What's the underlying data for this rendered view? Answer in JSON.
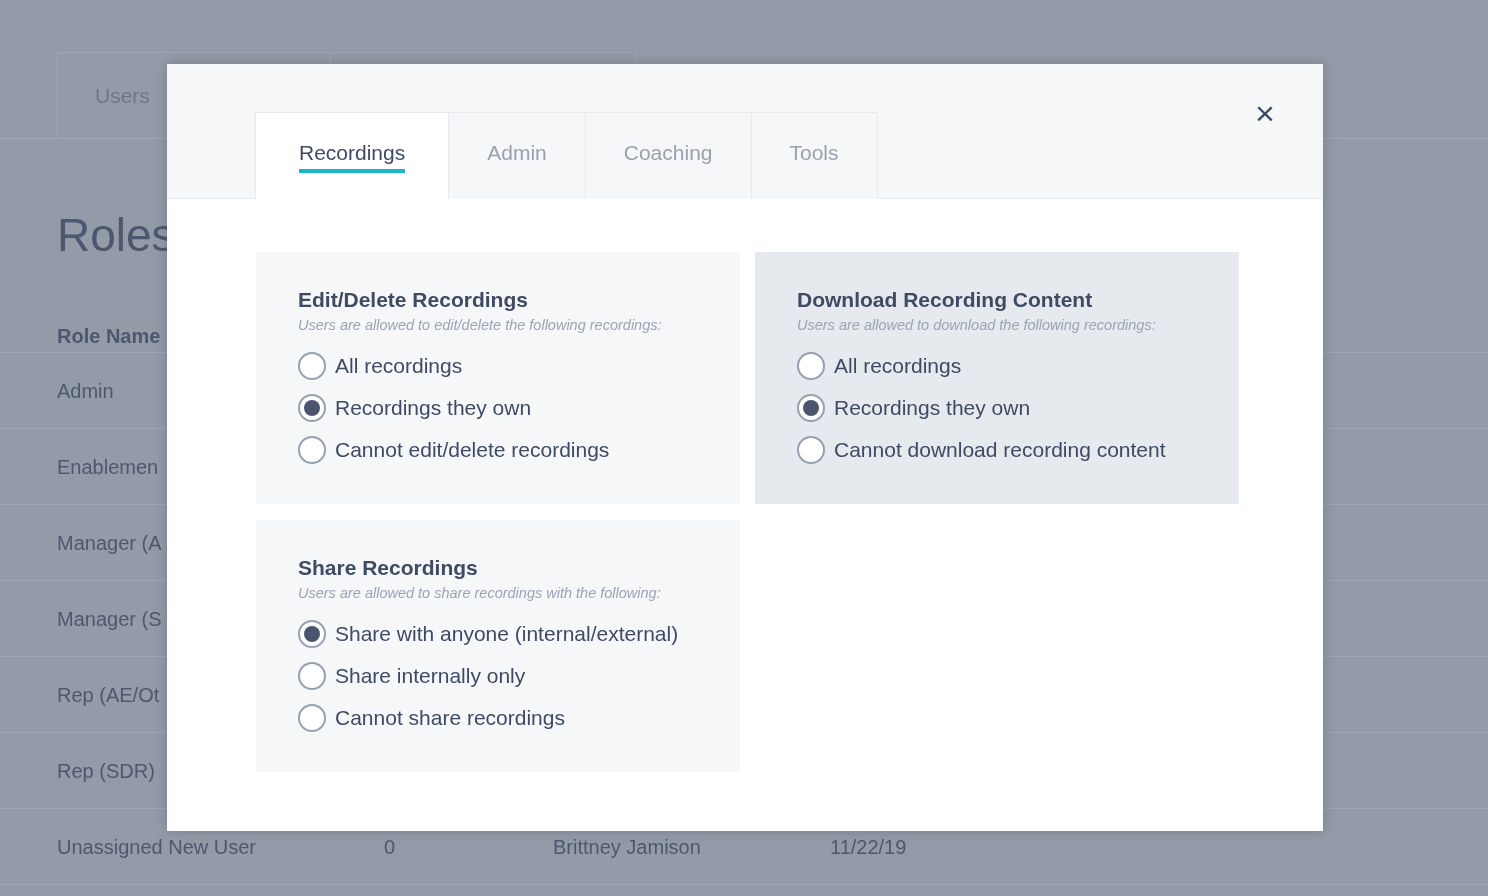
{
  "page": {
    "tabs": [
      {
        "label": "Users",
        "selected": false
      }
    ],
    "title": "Roles",
    "table": {
      "columns": [
        "Role Name"
      ],
      "rows": [
        {
          "cells": [
            "Admin"
          ]
        },
        {
          "cells": [
            "Enablemen"
          ]
        },
        {
          "cells": [
            "Manager (A"
          ]
        },
        {
          "cells": [
            "Manager (S"
          ]
        },
        {
          "cells": [
            "Rep (AE/Ot"
          ]
        },
        {
          "cells": [
            "Rep (SDR)"
          ]
        },
        {
          "cells": [
            "Unassigned New User",
            "0",
            "Brittney Jamison",
            "11/22/19"
          ]
        }
      ]
    }
  },
  "modal": {
    "close": "×",
    "tabs": [
      {
        "label": "Recordings",
        "selected": true
      },
      {
        "label": "Admin",
        "selected": false
      },
      {
        "label": "Coaching",
        "selected": false
      },
      {
        "label": "Tools",
        "selected": false
      }
    ],
    "cards": [
      {
        "title": "Edit/Delete Recordings",
        "subtitle": "Users are allowed to edit/delete the following recordings:",
        "highlighted": false,
        "options": [
          {
            "label": "All recordings",
            "selected": false
          },
          {
            "label": "Recordings they own",
            "selected": true
          },
          {
            "label": "Cannot edit/delete recordings",
            "selected": false
          }
        ]
      },
      {
        "title": "Download Recording Content",
        "subtitle": "Users are allowed to download the following recordings:",
        "highlighted": true,
        "options": [
          {
            "label": "All recordings",
            "selected": false
          },
          {
            "label": "Recordings they own",
            "selected": true
          },
          {
            "label": "Cannot download recording content",
            "selected": false
          }
        ]
      },
      {
        "title": "Share Recordings",
        "subtitle": "Users are allowed to share recordings with the following:",
        "highlighted": false,
        "options": [
          {
            "label": "Share with anyone (internal/external)",
            "selected": true
          },
          {
            "label": "Share internally only",
            "selected": false
          },
          {
            "label": "Cannot share recordings",
            "selected": false
          }
        ]
      }
    ]
  }
}
